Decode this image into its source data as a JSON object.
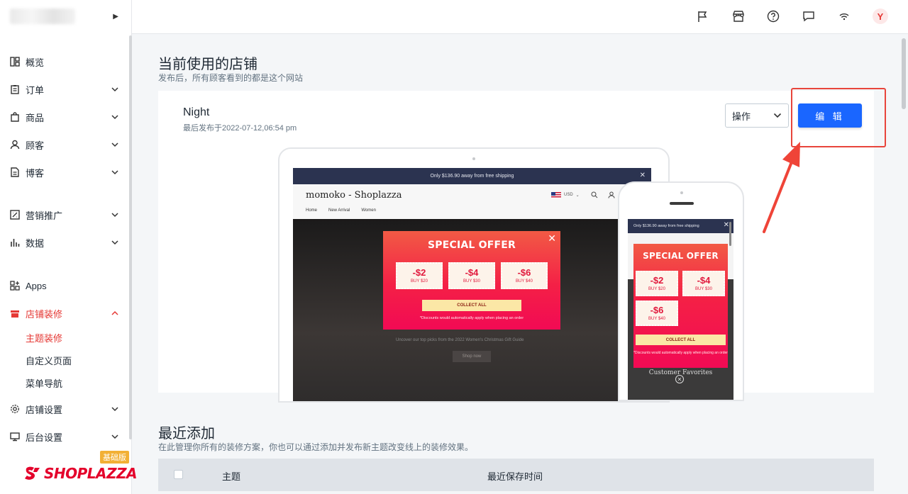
{
  "sidebar": {
    "items": [
      {
        "label": "概览",
        "icon": "overview-icon"
      },
      {
        "label": "订单",
        "icon": "order-icon"
      },
      {
        "label": "商品",
        "icon": "product-icon"
      },
      {
        "label": "顾客",
        "icon": "customer-icon"
      },
      {
        "label": "博客",
        "icon": "blog-icon"
      },
      {
        "label": "营销推广",
        "icon": "marketing-icon"
      },
      {
        "label": "数据",
        "icon": "analytics-icon"
      },
      {
        "label": "Apps",
        "icon": "apps-icon"
      },
      {
        "label": "店铺装修",
        "icon": "store-design-icon"
      },
      {
        "label": "店铺设置",
        "icon": "settings-icon"
      },
      {
        "label": "后台设置",
        "icon": "admin-settings-icon"
      }
    ],
    "sub_items": [
      {
        "label": "主题装修"
      },
      {
        "label": "自定义页面"
      },
      {
        "label": "菜单导航"
      }
    ],
    "plan_badge": "基础版",
    "logo_text": "SHOPLAZZA"
  },
  "topbar": {
    "icons": [
      "flag-icon",
      "store-icon",
      "help-icon",
      "message-icon",
      "wifi-icon"
    ],
    "avatar": "Y"
  },
  "current": {
    "title": "当前使用的店铺",
    "desc": "发布后，所有顾客看到的都是这个网站",
    "theme_name": "Night",
    "last_published": "最后发布于2022-07-12,06:54 pm",
    "actions_label": "操作",
    "edit_label": "编 辑"
  },
  "preview": {
    "shipping": "Only $136.90 away from free shipping",
    "brand": "momoko - Shoplazza",
    "menu": [
      "Home",
      "New Arrival",
      "Women"
    ],
    "currency": "USD",
    "hero_line": "Uncover our top picks from the 2022 Women's Christmas Gift Guide",
    "hero_btn": "Shop now",
    "popup_title": "SPECIAL OFFER",
    "coupons": [
      {
        "amount": "-$2",
        "buy": "BUY $20"
      },
      {
        "amount": "-$4",
        "buy": "BUY $30"
      },
      {
        "amount": "-$6",
        "buy": "BUY $40"
      }
    ],
    "collect": "COLLECT ALL",
    "note": "*Discounts would automatically apply when placing an order",
    "mobile_fav": "Customer Favorites"
  },
  "recent": {
    "title": "最近添加",
    "desc": "在此管理你所有的装修方案，你也可以通过添加并发布新主题改变线上的装修效果。",
    "col_theme": "主题",
    "col_saved": "最近保存时间"
  },
  "colors": {
    "accent": "#e53935",
    "primary_button": "#1a66ff",
    "popup": "#f42046"
  }
}
